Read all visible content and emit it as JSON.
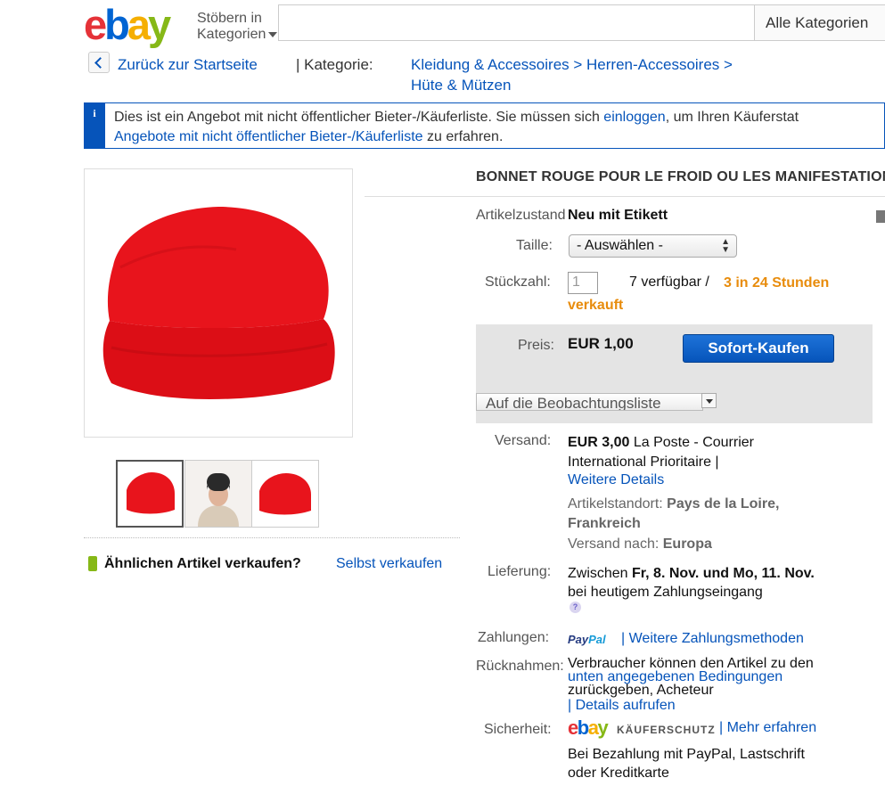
{
  "header": {
    "logo": [
      "e",
      "b",
      "a",
      "y"
    ],
    "browse_line1": "Stöbern in",
    "browse_line2": "Kategorien",
    "search_placeholder": "",
    "category_select": "Alle Kategorien"
  },
  "breadcrumb": {
    "back": "Zurück zur Startseite",
    "sep": "| Kategorie:",
    "line1": "Kleidung & Accessoires > Herren-Accessoires >",
    "line2": "Hüte & Mützen"
  },
  "info": {
    "icon": "i",
    "text1": "Dies ist ein Angebot mit nicht öffentlicher Bieter-/Käuferliste. Sie müssen sich ",
    "login": "einloggen",
    "text2": ", um Ihren Käuferstat",
    "link2": "Angebote mit nicht öffentlicher Bieter-/Käuferliste",
    "text3": " zu erfahren."
  },
  "seller": {
    "text": "Ähnlichen Artikel verkaufen?",
    "link": "Selbst verkaufen"
  },
  "item": {
    "title": "BONNET ROUGE POUR LE FROID OU LES MANIFESTATION",
    "condition_label": "Artikelzustand",
    "condition_value": "Neu mit Etikett",
    "size_label": "Taille:",
    "size_select": "- Auswählen -",
    "qty_label": "Stückzahl:",
    "qty_value": "1",
    "available": "7 verfügbar /",
    "sold_1": "3 in 24 Stunden",
    "sold_2": "verkauft",
    "price_label": "Preis:",
    "price_value": "EUR 1,00",
    "buy_button": "Sofort-Kaufen",
    "watch_button": "Auf die Beobachtungsliste"
  },
  "shipping": {
    "label": "Versand:",
    "price": "EUR 3,00",
    "service1": " La Poste - Courrier",
    "service2": "International Prioritaire |",
    "details_link": "Weitere Details",
    "location_label": "Artikelstandort: ",
    "location_1": "Pays de la Loire,",
    "location_2": "Frankreich",
    "to_label": "Versand nach: ",
    "to_value": "Europa"
  },
  "delivery": {
    "label": "Lieferung:",
    "pre": "Zwischen ",
    "dates": "Fr, 8. Nov. und Mo, 11. Nov.",
    "line2": "bei heutigem Zahlungseingang",
    "help_icon": "?"
  },
  "payment": {
    "label": "Zahlungen:",
    "paypal_1": "Pay",
    "paypal_2": "Pal",
    "link": "| Weitere Zahlungsmethoden"
  },
  "returns": {
    "label": "Rücknahmen:",
    "line1": "Verbraucher können den Artikel zu den",
    "link": "unten angegebenen Bedingungen",
    "line3": "zurückgeben, Acheteur",
    "details": "| Details aufrufen"
  },
  "security": {
    "label": "Sicherheit:",
    "logo": [
      "e",
      "b",
      "a",
      "y"
    ],
    "kaeufer": "KÄUFERSCHUTZ",
    "link": "| Mehr erfahren",
    "line1": "Bei Bezahlung mit PayPal, Lastschrift",
    "line2": "oder Kreditkarte"
  },
  "colors": {
    "accent": "#0654ba",
    "orange": "#e88c0c",
    "hat": "#e8141c"
  }
}
